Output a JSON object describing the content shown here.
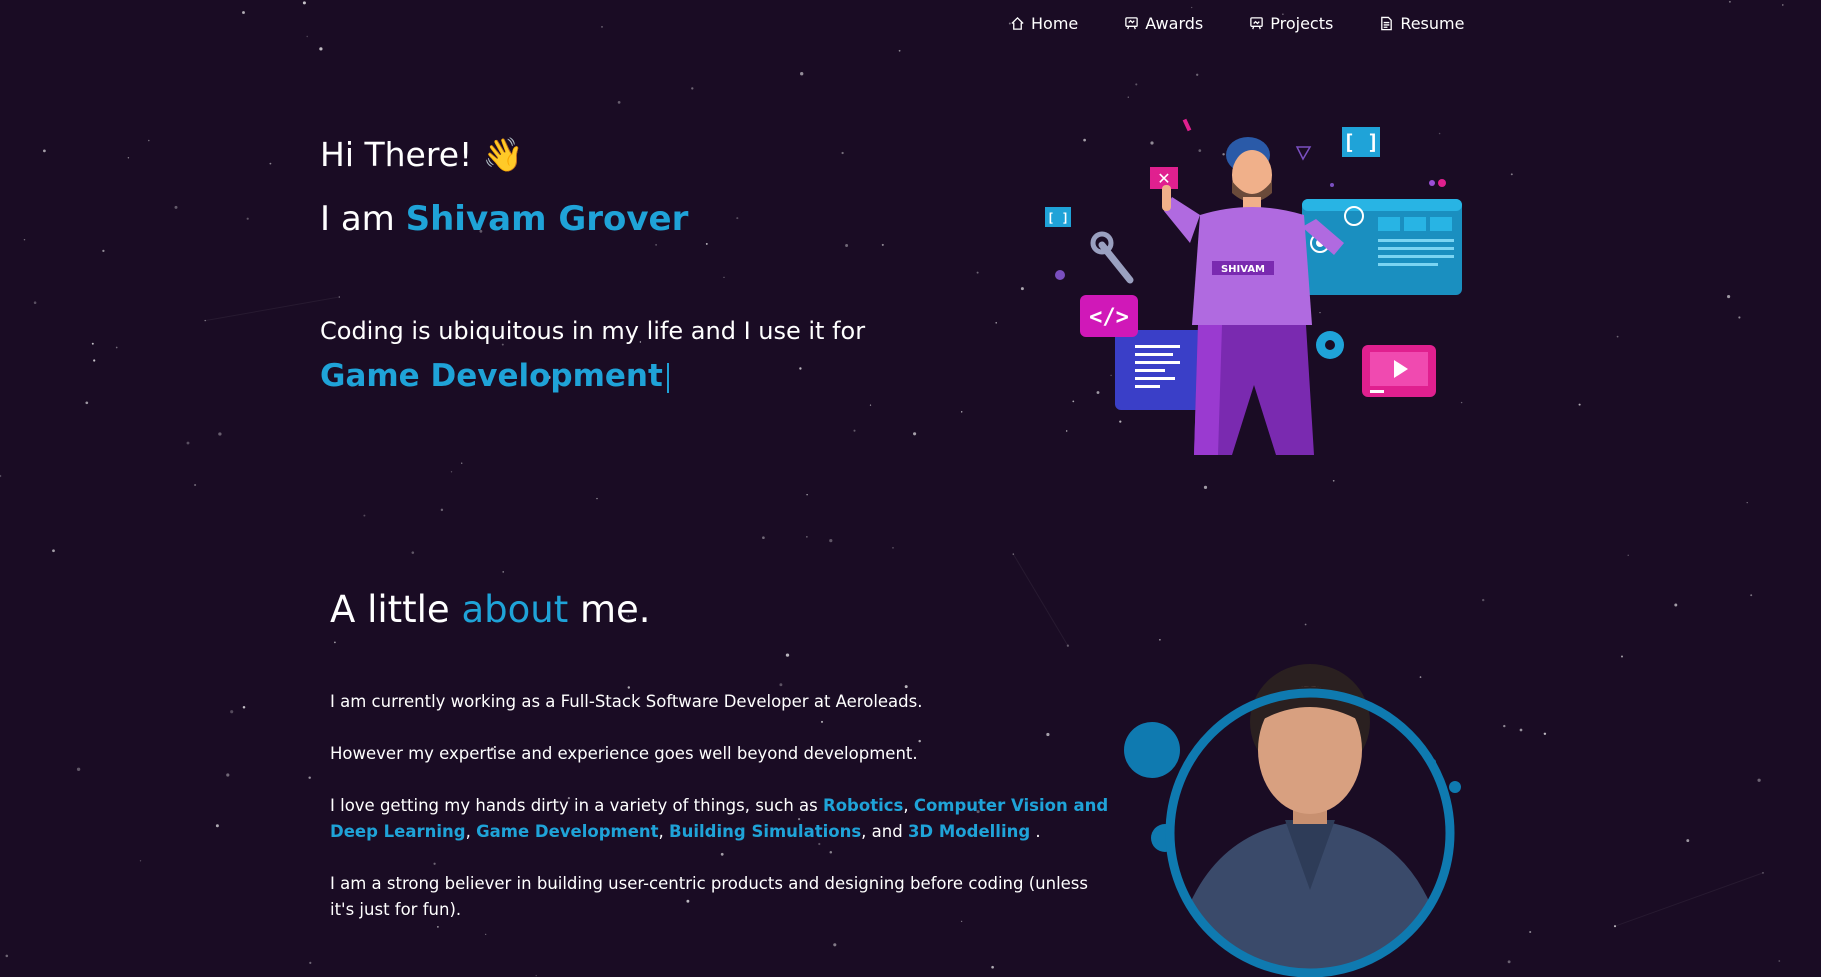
{
  "nav": {
    "items": [
      {
        "label": "Home",
        "icon": "home-icon"
      },
      {
        "label": "Awards",
        "icon": "awards-icon"
      },
      {
        "label": "Projects",
        "icon": "projects-icon"
      },
      {
        "label": "Resume",
        "icon": "resume-icon"
      }
    ]
  },
  "hero": {
    "greeting": "Hi There!",
    "wave_emoji": "👋",
    "intro_prefix": "I am ",
    "name": "Shivam Grover",
    "tagline": "Coding is ubiquitous in my life and I use it for",
    "typed_text": "Game Development",
    "shirt_label": "SHIVAM"
  },
  "about": {
    "title_prefix": "A little ",
    "title_highlight": "about",
    "title_suffix": " me.",
    "p1": "I am currently working as a Full-Stack Software Developer at Aeroleads.",
    "p2": "However my expertise and experience goes well beyond development.",
    "p3_prefix": "I love getting my hands dirty in a variety of things, such as ",
    "skills": [
      "Robotics",
      "Computer Vision and Deep Learning",
      "Game Development",
      "Building Simulations",
      "3D Modelling"
    ],
    "sep_comma": ", ",
    "sep_and": ", and ",
    "p3_suffix": " .",
    "p4": "I am a strong believer in building user-centric products and designing before coding (unless it's just for fun)."
  },
  "colors": {
    "background": "#1a0c24",
    "accent": "#1fa3d8",
    "magenta": "#e0208f",
    "purple": "#9b4fd8"
  }
}
